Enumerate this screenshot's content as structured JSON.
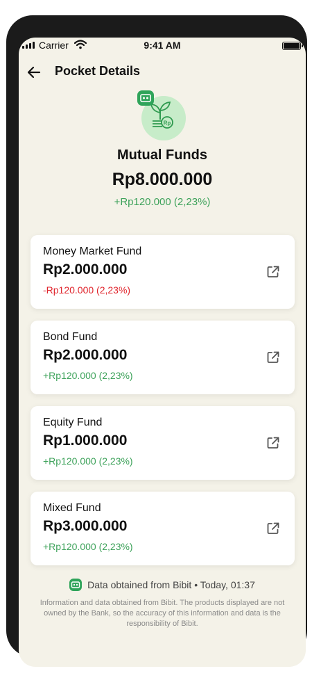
{
  "status_bar": {
    "carrier": "Carrier",
    "time": "9:41 AM"
  },
  "header": {
    "title": "Pocket Details"
  },
  "pocket": {
    "name": "Mutual Funds",
    "total": "Rp8.000.000",
    "change": "+Rp120.000 (2,23%)"
  },
  "funds": [
    {
      "name": "Money Market Fund",
      "amount": "Rp2.000.000",
      "change": "-Rp120.000 (2,23%)",
      "trend": "negative"
    },
    {
      "name": "Bond Fund",
      "amount": "Rp2.000.000",
      "change": "+Rp120.000 (2,23%)",
      "trend": "positive"
    },
    {
      "name": "Equity Fund",
      "amount": "Rp1.000.000",
      "change": "+Rp120.000 (2,23%)",
      "trend": "positive"
    },
    {
      "name": "Mixed Fund",
      "amount": "Rp3.000.000",
      "change": "+Rp120.000 (2,23%)",
      "trend": "positive"
    }
  ],
  "footer": {
    "source": "Data obtained from Bibit • Today, 01:37",
    "disclaimer": "Information and data obtained from Bibit. The products displayed are not owned by the Bank, so the accuracy of this information and data is the responsibility of Bibit."
  },
  "icons": {
    "back": "arrow-left-icon",
    "open": "external-link-icon",
    "pocket": "plant-coin-icon",
    "source": "bibit-logo-icon"
  },
  "colors": {
    "background": "#f4f2e8",
    "positive": "#3da25a",
    "negative": "#e0242c",
    "brand_green": "#2fa45a"
  }
}
